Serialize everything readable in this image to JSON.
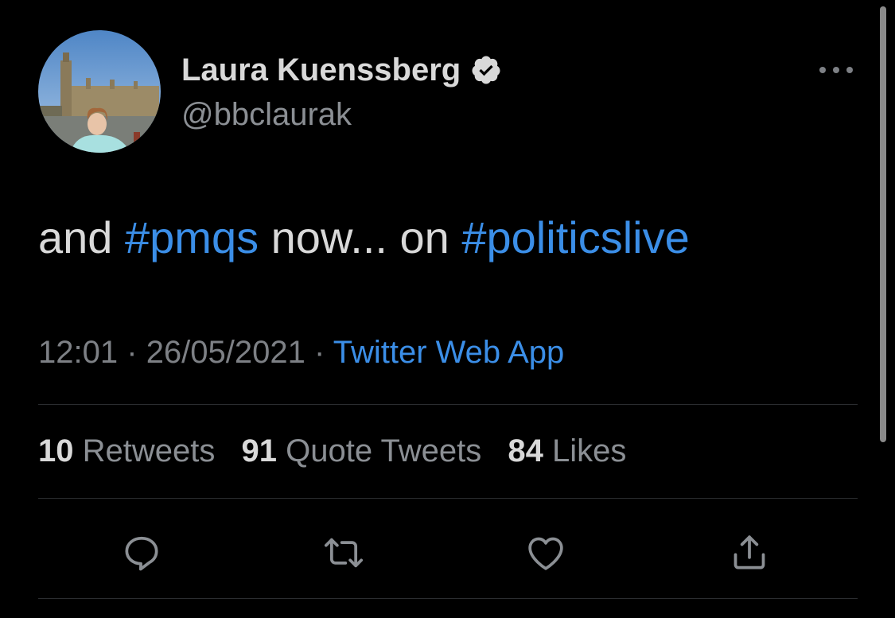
{
  "author": {
    "display_name": "Laura Kuenssberg",
    "handle": "@bbclaurak",
    "verified": true,
    "avatar_icon": "profile-photo"
  },
  "tweet": {
    "segments": [
      {
        "text": "and ",
        "type": "text"
      },
      {
        "text": "#pmqs",
        "type": "hashtag"
      },
      {
        "text": " now... on ",
        "type": "text"
      },
      {
        "text": "#politicslive",
        "type": "hashtag"
      }
    ]
  },
  "meta": {
    "time": "12:01",
    "separator": "·",
    "date": "26/05/2021",
    "source": "Twitter Web App"
  },
  "stats": {
    "retweets_count": "10",
    "retweets_label": "Retweets",
    "quotes_count": "91",
    "quotes_label": "Quote Tweets",
    "likes_count": "84",
    "likes_label": "Likes"
  },
  "actions": [
    {
      "name": "reply",
      "icon": "reply-icon"
    },
    {
      "name": "retweet",
      "icon": "retweet-icon"
    },
    {
      "name": "like",
      "icon": "heart-icon"
    },
    {
      "name": "share",
      "icon": "share-icon"
    }
  ],
  "colors": {
    "background": "#000000",
    "text": "#d9d9d9",
    "secondary": "#8b8f94",
    "link": "#3b8ee7",
    "divider": "#2b2d30"
  }
}
